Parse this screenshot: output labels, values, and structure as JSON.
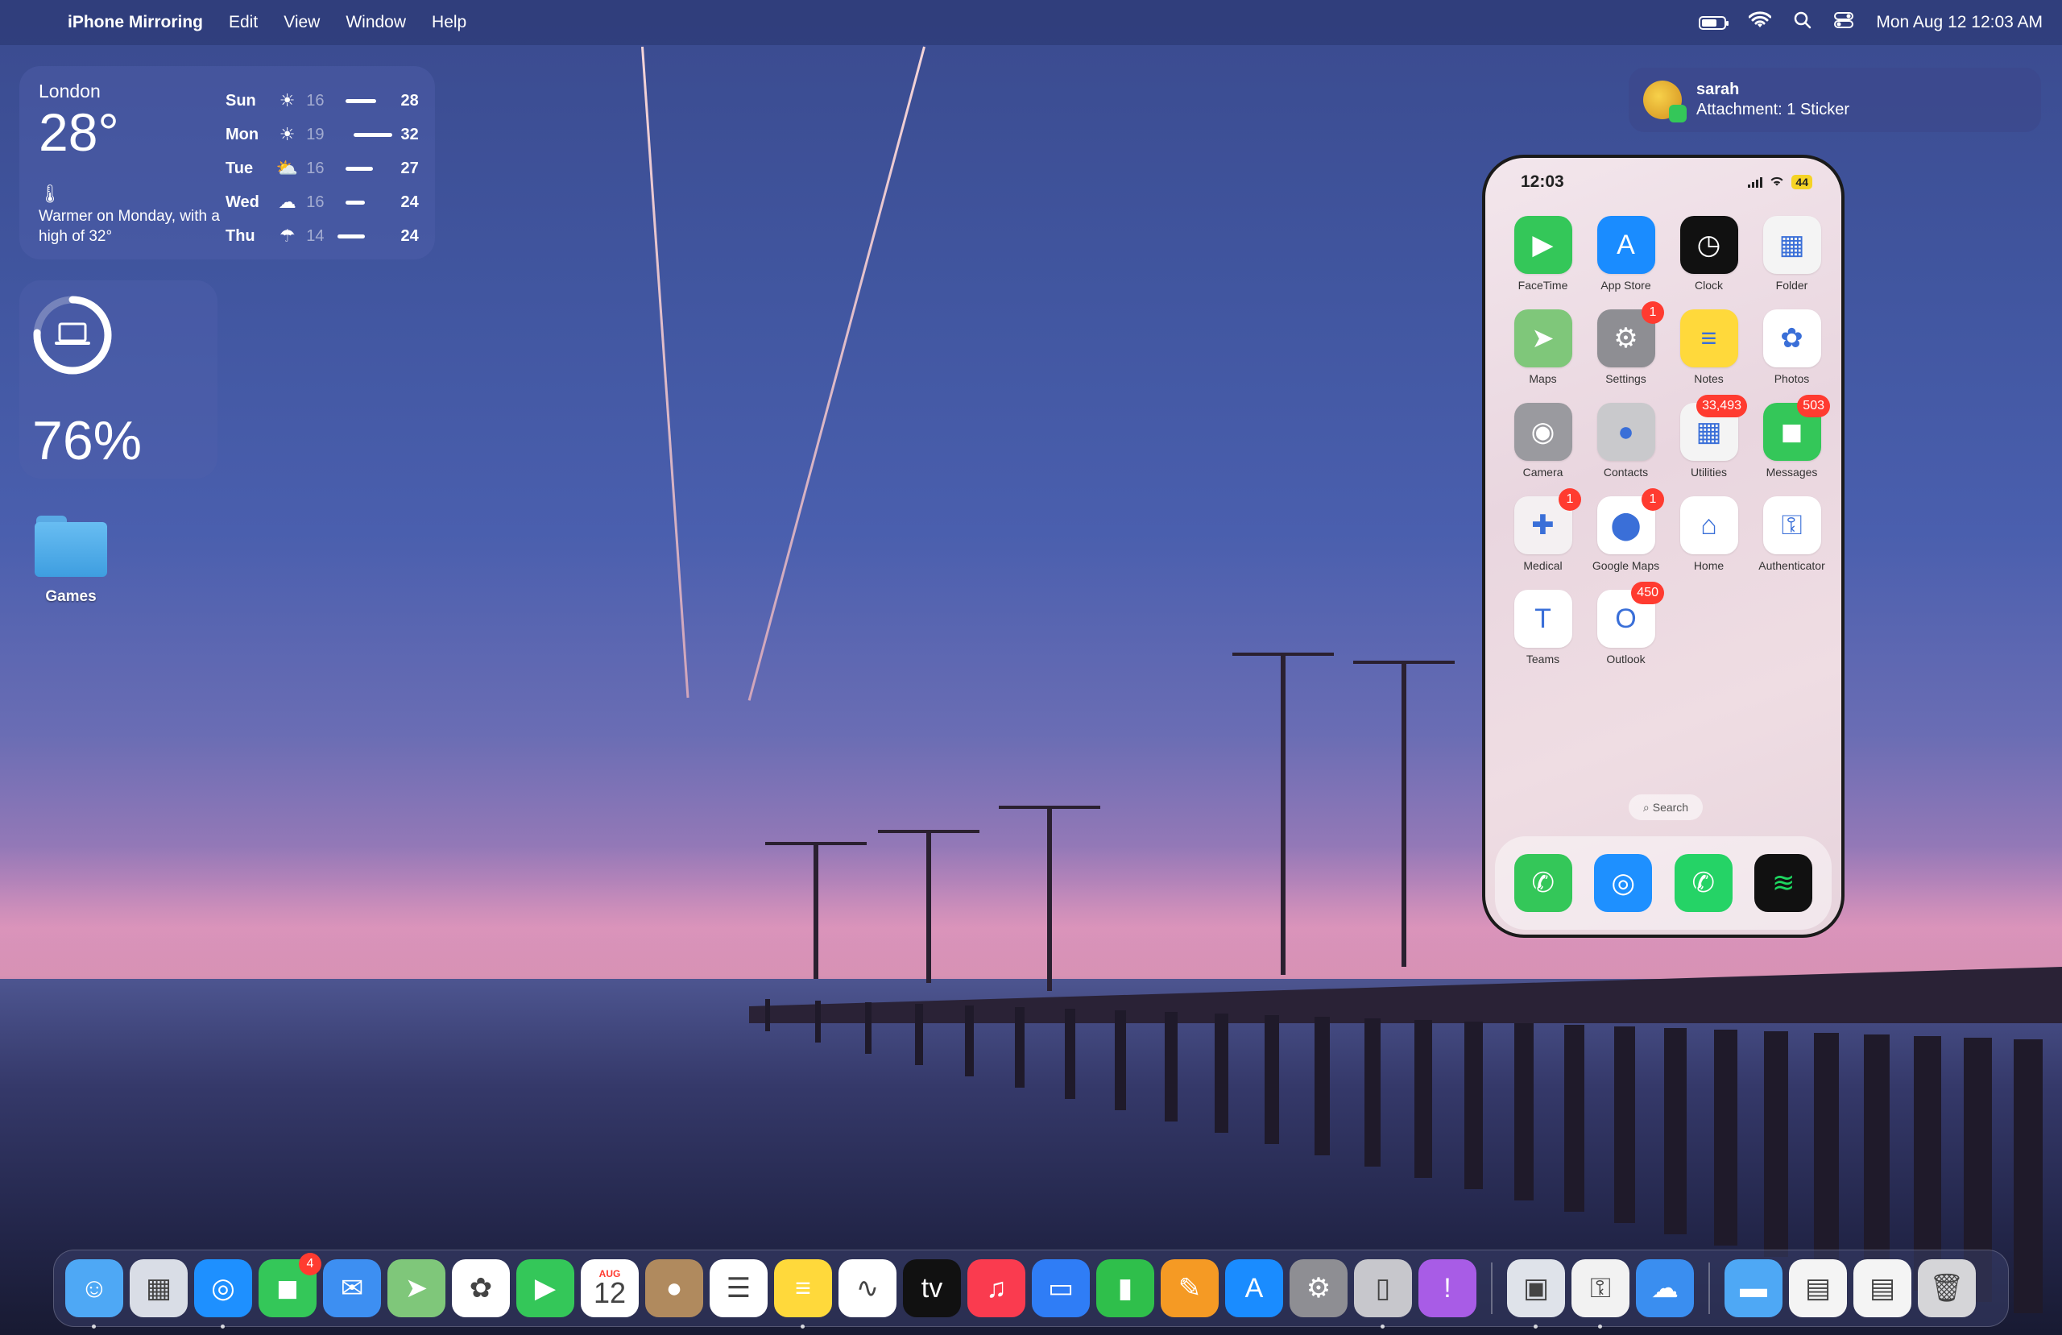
{
  "menubar": {
    "app_name": "iPhone Mirroring",
    "menus": [
      "Edit",
      "View",
      "Window",
      "Help"
    ],
    "clock": "Mon Aug 12  12:03 AM"
  },
  "weather": {
    "city": "London",
    "temp": "28°",
    "note": "Warmer on Monday, with a high of 32°",
    "forecast": [
      {
        "day": "Sun",
        "icon": "sun-icon",
        "low": "16",
        "high": "28",
        "range": [
          0.15,
          0.7
        ]
      },
      {
        "day": "Mon",
        "icon": "sun-icon",
        "low": "19",
        "high": "32",
        "range": [
          0.3,
          1.0
        ]
      },
      {
        "day": "Tue",
        "icon": "partly-cloudy-icon",
        "low": "16",
        "high": "27",
        "range": [
          0.15,
          0.65
        ]
      },
      {
        "day": "Wed",
        "icon": "cloud-icon",
        "low": "16",
        "high": "24",
        "range": [
          0.15,
          0.5
        ]
      },
      {
        "day": "Thu",
        "icon": "rain-icon",
        "low": "14",
        "high": "24",
        "range": [
          0.0,
          0.5
        ]
      }
    ]
  },
  "battery_widget": {
    "percent": "76%",
    "level": 0.76
  },
  "desktop": {
    "folder_label": "Games"
  },
  "notification": {
    "sender": "sarah",
    "message": "Attachment: 1 Sticker"
  },
  "iphone": {
    "time": "12:03",
    "battery": "44",
    "search_label": "Search",
    "apps": [
      {
        "label": "FaceTime",
        "icon": "facetime-icon",
        "color": "#34c759",
        "glyph": "▶",
        "badge": ""
      },
      {
        "label": "App Store",
        "icon": "app-store-icon",
        "color": "#1a8cff",
        "glyph": "A",
        "badge": ""
      },
      {
        "label": "Clock",
        "icon": "clock-icon",
        "color": "#111111",
        "glyph": "◷",
        "badge": ""
      },
      {
        "label": "Folder",
        "icon": "folder-icon",
        "color": "#f4f4f4",
        "glyph": "▦",
        "badge": ""
      },
      {
        "label": "Maps",
        "icon": "maps-icon",
        "color": "#7fc77a",
        "glyph": "➤",
        "badge": ""
      },
      {
        "label": "Settings",
        "icon": "settings-icon",
        "color": "#8e8e93",
        "glyph": "⚙",
        "badge": "1"
      },
      {
        "label": "Notes",
        "icon": "notes-icon",
        "color": "#ffd93b",
        "glyph": "≡",
        "badge": ""
      },
      {
        "label": "Photos",
        "icon": "photos-icon",
        "color": "#ffffff",
        "glyph": "✿",
        "badge": ""
      },
      {
        "label": "Camera",
        "icon": "camera-icon",
        "color": "#9a9a9f",
        "glyph": "◉",
        "badge": ""
      },
      {
        "label": "Contacts",
        "icon": "contacts-icon",
        "color": "#c9c9cc",
        "glyph": "●",
        "badge": ""
      },
      {
        "label": "Utilities",
        "icon": "utilities-icon",
        "color": "#f4f4f4",
        "glyph": "▦",
        "badge": "33,493"
      },
      {
        "label": "Messages",
        "icon": "messages-icon",
        "color": "#34c759",
        "glyph": "◼",
        "badge": "503"
      },
      {
        "label": "Medical",
        "icon": "medical-icon",
        "color": "#f4f0f2",
        "glyph": "✚",
        "badge": "1"
      },
      {
        "label": "Google Maps",
        "icon": "google-maps-icon",
        "color": "#ffffff",
        "glyph": "⬤",
        "badge": "1"
      },
      {
        "label": "Home",
        "icon": "home-icon",
        "color": "#ffffff",
        "glyph": "⌂",
        "badge": ""
      },
      {
        "label": "Authenticator",
        "icon": "authenticator-icon",
        "color": "#ffffff",
        "glyph": "⚿",
        "badge": ""
      },
      {
        "label": "Teams",
        "icon": "teams-icon",
        "color": "#ffffff",
        "glyph": "T",
        "badge": ""
      },
      {
        "label": "Outlook",
        "icon": "outlook-icon",
        "color": "#ffffff",
        "glyph": "O",
        "badge": "450"
      }
    ],
    "dock": [
      {
        "icon": "phone-icon",
        "color": "#34c759",
        "glyph": "✆"
      },
      {
        "icon": "safari-icon",
        "color": "#1e90ff",
        "glyph": "◎"
      },
      {
        "icon": "whatsapp-icon",
        "color": "#25d366",
        "glyph": "✆"
      },
      {
        "icon": "spotify-icon",
        "color": "#111111",
        "glyph": "≋"
      }
    ]
  },
  "dock": {
    "apps": [
      {
        "icon": "finder-icon",
        "color": "#4ea8f5",
        "glyph": "☺",
        "running": true,
        "badge": ""
      },
      {
        "icon": "launchpad-icon",
        "color": "#d9dde6",
        "glyph": "▦",
        "running": false,
        "badge": ""
      },
      {
        "icon": "safari-icon",
        "color": "#1e90ff",
        "glyph": "◎",
        "running": true,
        "badge": ""
      },
      {
        "icon": "messages-icon",
        "color": "#34c759",
        "glyph": "◼",
        "running": false,
        "badge": "4"
      },
      {
        "icon": "mail-icon",
        "color": "#3d8ff2",
        "glyph": "✉",
        "running": false,
        "badge": ""
      },
      {
        "icon": "maps-icon",
        "color": "#7fc77a",
        "glyph": "➤",
        "running": false,
        "badge": ""
      },
      {
        "icon": "photos-icon",
        "color": "#ffffff",
        "glyph": "✿",
        "running": false,
        "badge": ""
      },
      {
        "icon": "facetime-icon",
        "color": "#34c759",
        "glyph": "▶",
        "running": false,
        "badge": ""
      },
      {
        "icon": "calendar-icon",
        "color": "#ffffff",
        "glyph": "",
        "running": false,
        "badge": ""
      },
      {
        "icon": "contacts-icon",
        "color": "#b08a5e",
        "glyph": "●",
        "running": false,
        "badge": ""
      },
      {
        "icon": "reminders-icon",
        "color": "#ffffff",
        "glyph": "☰",
        "running": false,
        "badge": ""
      },
      {
        "icon": "notes-icon",
        "color": "#ffd93b",
        "glyph": "≡",
        "running": true,
        "badge": ""
      },
      {
        "icon": "freeform-icon",
        "color": "#ffffff",
        "glyph": "∿",
        "running": false,
        "badge": ""
      },
      {
        "icon": "tv-icon",
        "color": "#111111",
        "glyph": "tv",
        "running": false,
        "badge": ""
      },
      {
        "icon": "music-icon",
        "color": "#fa3b4f",
        "glyph": "♫",
        "running": false,
        "badge": ""
      },
      {
        "icon": "keynote-icon",
        "color": "#2f7df6",
        "glyph": "▭",
        "running": false,
        "badge": ""
      },
      {
        "icon": "numbers-icon",
        "color": "#2fbf4b",
        "glyph": "▮",
        "running": false,
        "badge": ""
      },
      {
        "icon": "pages-icon",
        "color": "#f59a24",
        "glyph": "✎",
        "running": false,
        "badge": ""
      },
      {
        "icon": "app-store-icon",
        "color": "#1a8cff",
        "glyph": "A",
        "running": false,
        "badge": ""
      },
      {
        "icon": "system-settings-icon",
        "color": "#8e8e93",
        "glyph": "⚙",
        "running": false,
        "badge": ""
      },
      {
        "icon": "iphone-mirroring-icon",
        "color": "#c7c7cc",
        "glyph": "▯",
        "running": true,
        "badge": ""
      },
      {
        "icon": "feedback-icon",
        "color": "#a85ce6",
        "glyph": "!",
        "running": false,
        "badge": ""
      }
    ],
    "recent": [
      {
        "icon": "preview-icon",
        "color": "#dfe3ea",
        "glyph": "▣",
        "running": true
      },
      {
        "icon": "keychain-icon",
        "color": "#f2f2f2",
        "glyph": "⚿",
        "running": true
      },
      {
        "icon": "weather-icon",
        "color": "#3a8ef0",
        "glyph": "☁",
        "running": false
      }
    ],
    "stacks": [
      {
        "icon": "folder-stack-icon",
        "color": "#4ea8f5",
        "glyph": "▬"
      },
      {
        "icon": "documents-stack-icon",
        "color": "#f4f4f4",
        "glyph": "▤"
      },
      {
        "icon": "downloads-stack-icon",
        "color": "#f4f4f4",
        "glyph": "▤"
      },
      {
        "icon": "trash-icon",
        "color": "#d5d5d8",
        "glyph": "🗑"
      }
    ]
  }
}
